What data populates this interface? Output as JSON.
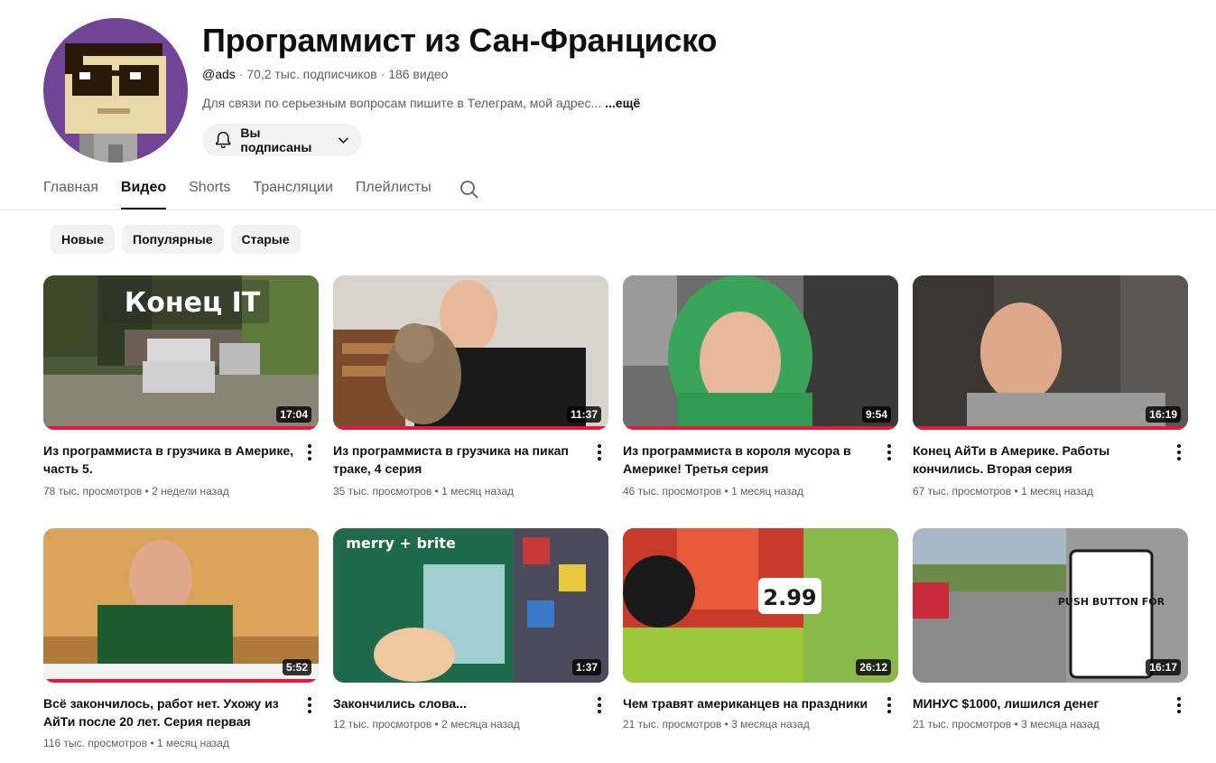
{
  "channel": {
    "name": "Программист из Сан-Франциско",
    "handle": "@ads",
    "subscribers": "70,2 тыс. подписчиков",
    "video_count": "186 видео",
    "description": "Для связи по серьезным вопросам пишите в Телеграм, мой адрес...",
    "more_label": "...ещё",
    "subscribe_label": "Вы подписаны"
  },
  "tabs": [
    {
      "label": "Главная"
    },
    {
      "label": "Видео"
    },
    {
      "label": "Shorts"
    },
    {
      "label": "Трансляции"
    },
    {
      "label": "Плейлисты"
    }
  ],
  "active_tab": "Видео",
  "chips": [
    {
      "label": "Новые"
    },
    {
      "label": "Популярные"
    },
    {
      "label": "Старые"
    }
  ],
  "colors": {
    "progress": "#e8173b",
    "chip_bg": "#f2f2f2",
    "avatar_bg": "#6b3f8f"
  },
  "videos": [
    {
      "thumb_text": "Конец IT",
      "duration": "17:04",
      "title": "Из программиста в грузчика в Америке, часть 5.",
      "views": "78 тыс. просмотров",
      "age": "2 недели назад",
      "watched": 1
    },
    {
      "duration": "11:37",
      "title": "Из программиста в грузчика на пикап траке, 4 серия",
      "views": "35 тыс. просмотров",
      "age": "1 месяц назад",
      "watched": 1
    },
    {
      "duration": "9:54",
      "title": "Из программиста в короля мусора в Америке! Третья серия",
      "views": "46 тыс. просмотров",
      "age": "1 месяц назад",
      "watched": 1
    },
    {
      "duration": "16:19",
      "title": "Конец АйТи в Америке. Работы кончились. Вторая серия",
      "views": "67 тыс. просмотров",
      "age": "1 месяц назад",
      "watched": 1
    },
    {
      "duration": "5:52",
      "title": "Всё закончилось, работ нет. Ухожу из АйТи после 20 лет. Серия первая",
      "views": "116 тыс. просмотров",
      "age": "1 месяц назад",
      "watched": 1
    },
    {
      "thumb_text": "merry + brite",
      "duration": "1:37",
      "title": "Закончились слова...",
      "views": "12 тыс. просмотров",
      "age": "2 месяца назад",
      "watched": 0
    },
    {
      "thumb_text": "2.99",
      "duration": "26:12",
      "title": "Чем травят американцев на праздники",
      "views": "21 тыс. просмотров",
      "age": "3 месяца назад",
      "watched": 0
    },
    {
      "thumb_text": "PUSH BUTTON FOR",
      "duration": "16:17",
      "title": "МИНУС $1000, лишился денег",
      "views": "21 тыс. просмотров",
      "age": "3 месяца назад",
      "watched": 0
    }
  ]
}
